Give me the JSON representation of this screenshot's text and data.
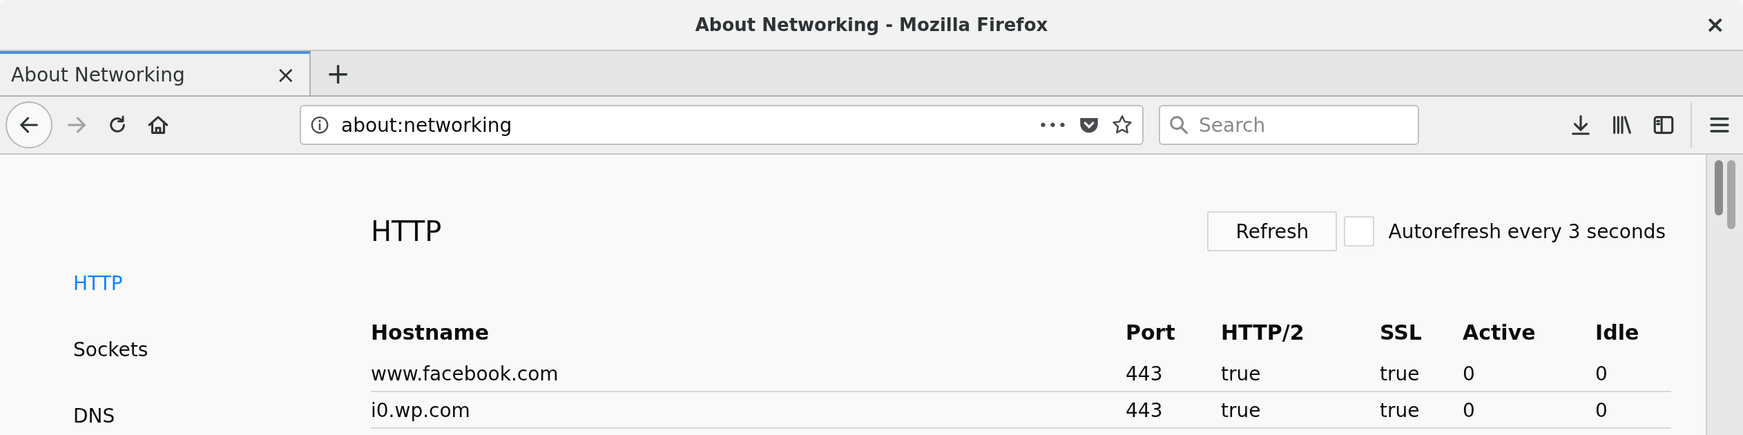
{
  "window": {
    "title": "About Networking - Mozilla Firefox",
    "close": "×"
  },
  "tabs": [
    {
      "label": "About Networking",
      "selected": true,
      "close": "×"
    }
  ],
  "new_tab": "+",
  "url_bar": {
    "value": "about:networking",
    "more": "•••"
  },
  "search": {
    "placeholder": "Search"
  },
  "sidebar": {
    "items": [
      {
        "label": "HTTP",
        "selected": true
      },
      {
        "label": "Sockets",
        "selected": false
      },
      {
        "label": "DNS",
        "selected": false
      }
    ]
  },
  "section": {
    "title": "HTTP",
    "refresh": "Refresh",
    "autorefresh": {
      "label": "Autorefresh every 3 seconds",
      "checked": false
    }
  },
  "table": {
    "columns": [
      "Hostname",
      "Port",
      "HTTP/2",
      "SSL",
      "Active",
      "Idle"
    ],
    "rows": [
      [
        "www.facebook.com",
        "443",
        "true",
        "true",
        "0",
        "0"
      ],
      [
        "i0.wp.com",
        "443",
        "true",
        "true",
        "0",
        "0"
      ]
    ]
  }
}
